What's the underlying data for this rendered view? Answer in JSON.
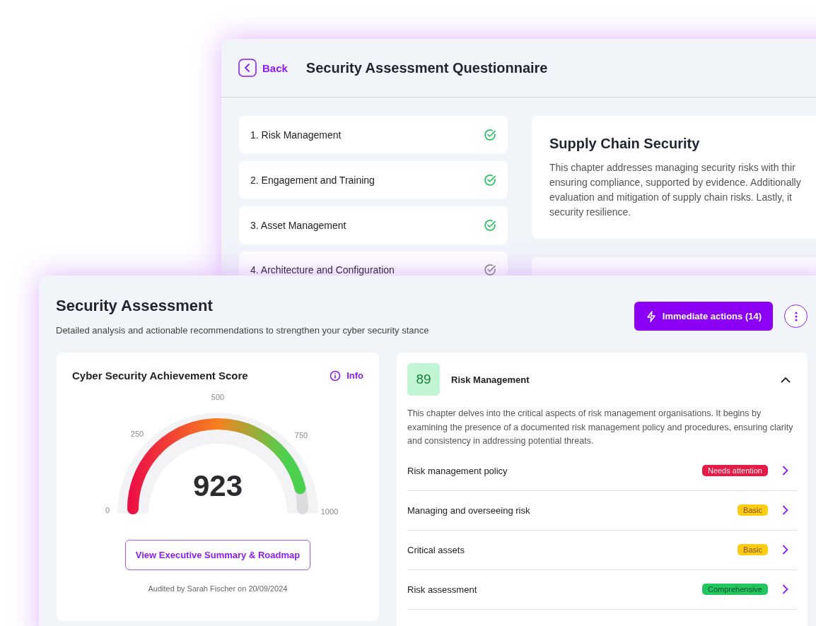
{
  "questionnaire": {
    "back_label": "Back",
    "title": "Security Assessment Questionnaire",
    "chapters": [
      {
        "label": "1. Risk Management",
        "checked": true
      },
      {
        "label": "2. Engagement and Training",
        "checked": true
      },
      {
        "label": "3. Asset Management",
        "checked": true
      },
      {
        "label": "4. Architecture and Configuration",
        "checked": false
      }
    ],
    "detail": {
      "title": "Supply Chain Security",
      "lines": [
        "This chapter addresses managing security risks with thir",
        "ensuring compliance, supported by evidence. Additionally",
        "evaluation and mitigation of supply chain risks. Lastly, it",
        "security resilience."
      ]
    }
  },
  "assessment": {
    "title": "Security Assessment",
    "subtitle": "Detailed analysis and actionable recommendations to strengthen your cyber security stance",
    "action_button": "Immediate actions (14)",
    "score_card": {
      "title": "Cyber Security Achievement Score",
      "info_label": "Info",
      "score": "923",
      "ticks": [
        "0",
        "250",
        "500",
        "750",
        "1000"
      ],
      "summary_button": "View Executive Summary & Roadmap",
      "audited": "Audited by Sarah Fischer on 20/09/2024"
    },
    "chapter": {
      "score": "89",
      "title": "Risk Management",
      "expanded": true,
      "description": "This chapter delves into the critical aspects of risk management organisations. It begins by examining the presence of a documented risk management policy and procedures, ensuring clarity and consistency in addressing potential threats.",
      "items": [
        {
          "label": "Risk management policy",
          "status": "Needs attention",
          "color": "#e11d48"
        },
        {
          "label": "Managing and overseeing risk",
          "status": "Basic",
          "color": "#facc15"
        },
        {
          "label": "Critical assets",
          "status": "Basic",
          "color": "#facc15"
        },
        {
          "label": "Risk assessment",
          "status": "Comprehensive",
          "color": "#22c55e"
        }
      ]
    }
  }
}
